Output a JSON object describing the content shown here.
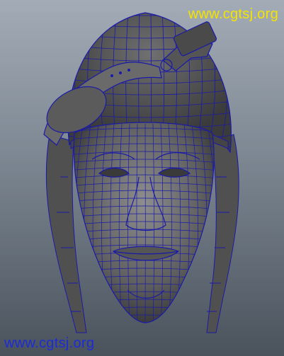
{
  "watermarks": {
    "top": "www.cgtsj.org",
    "bottom": "www.cgtsj.org"
  },
  "colors": {
    "wire": "#1a1aa8",
    "top_watermark": "#f4e400",
    "bottom_watermark": "#1d2bd6"
  }
}
